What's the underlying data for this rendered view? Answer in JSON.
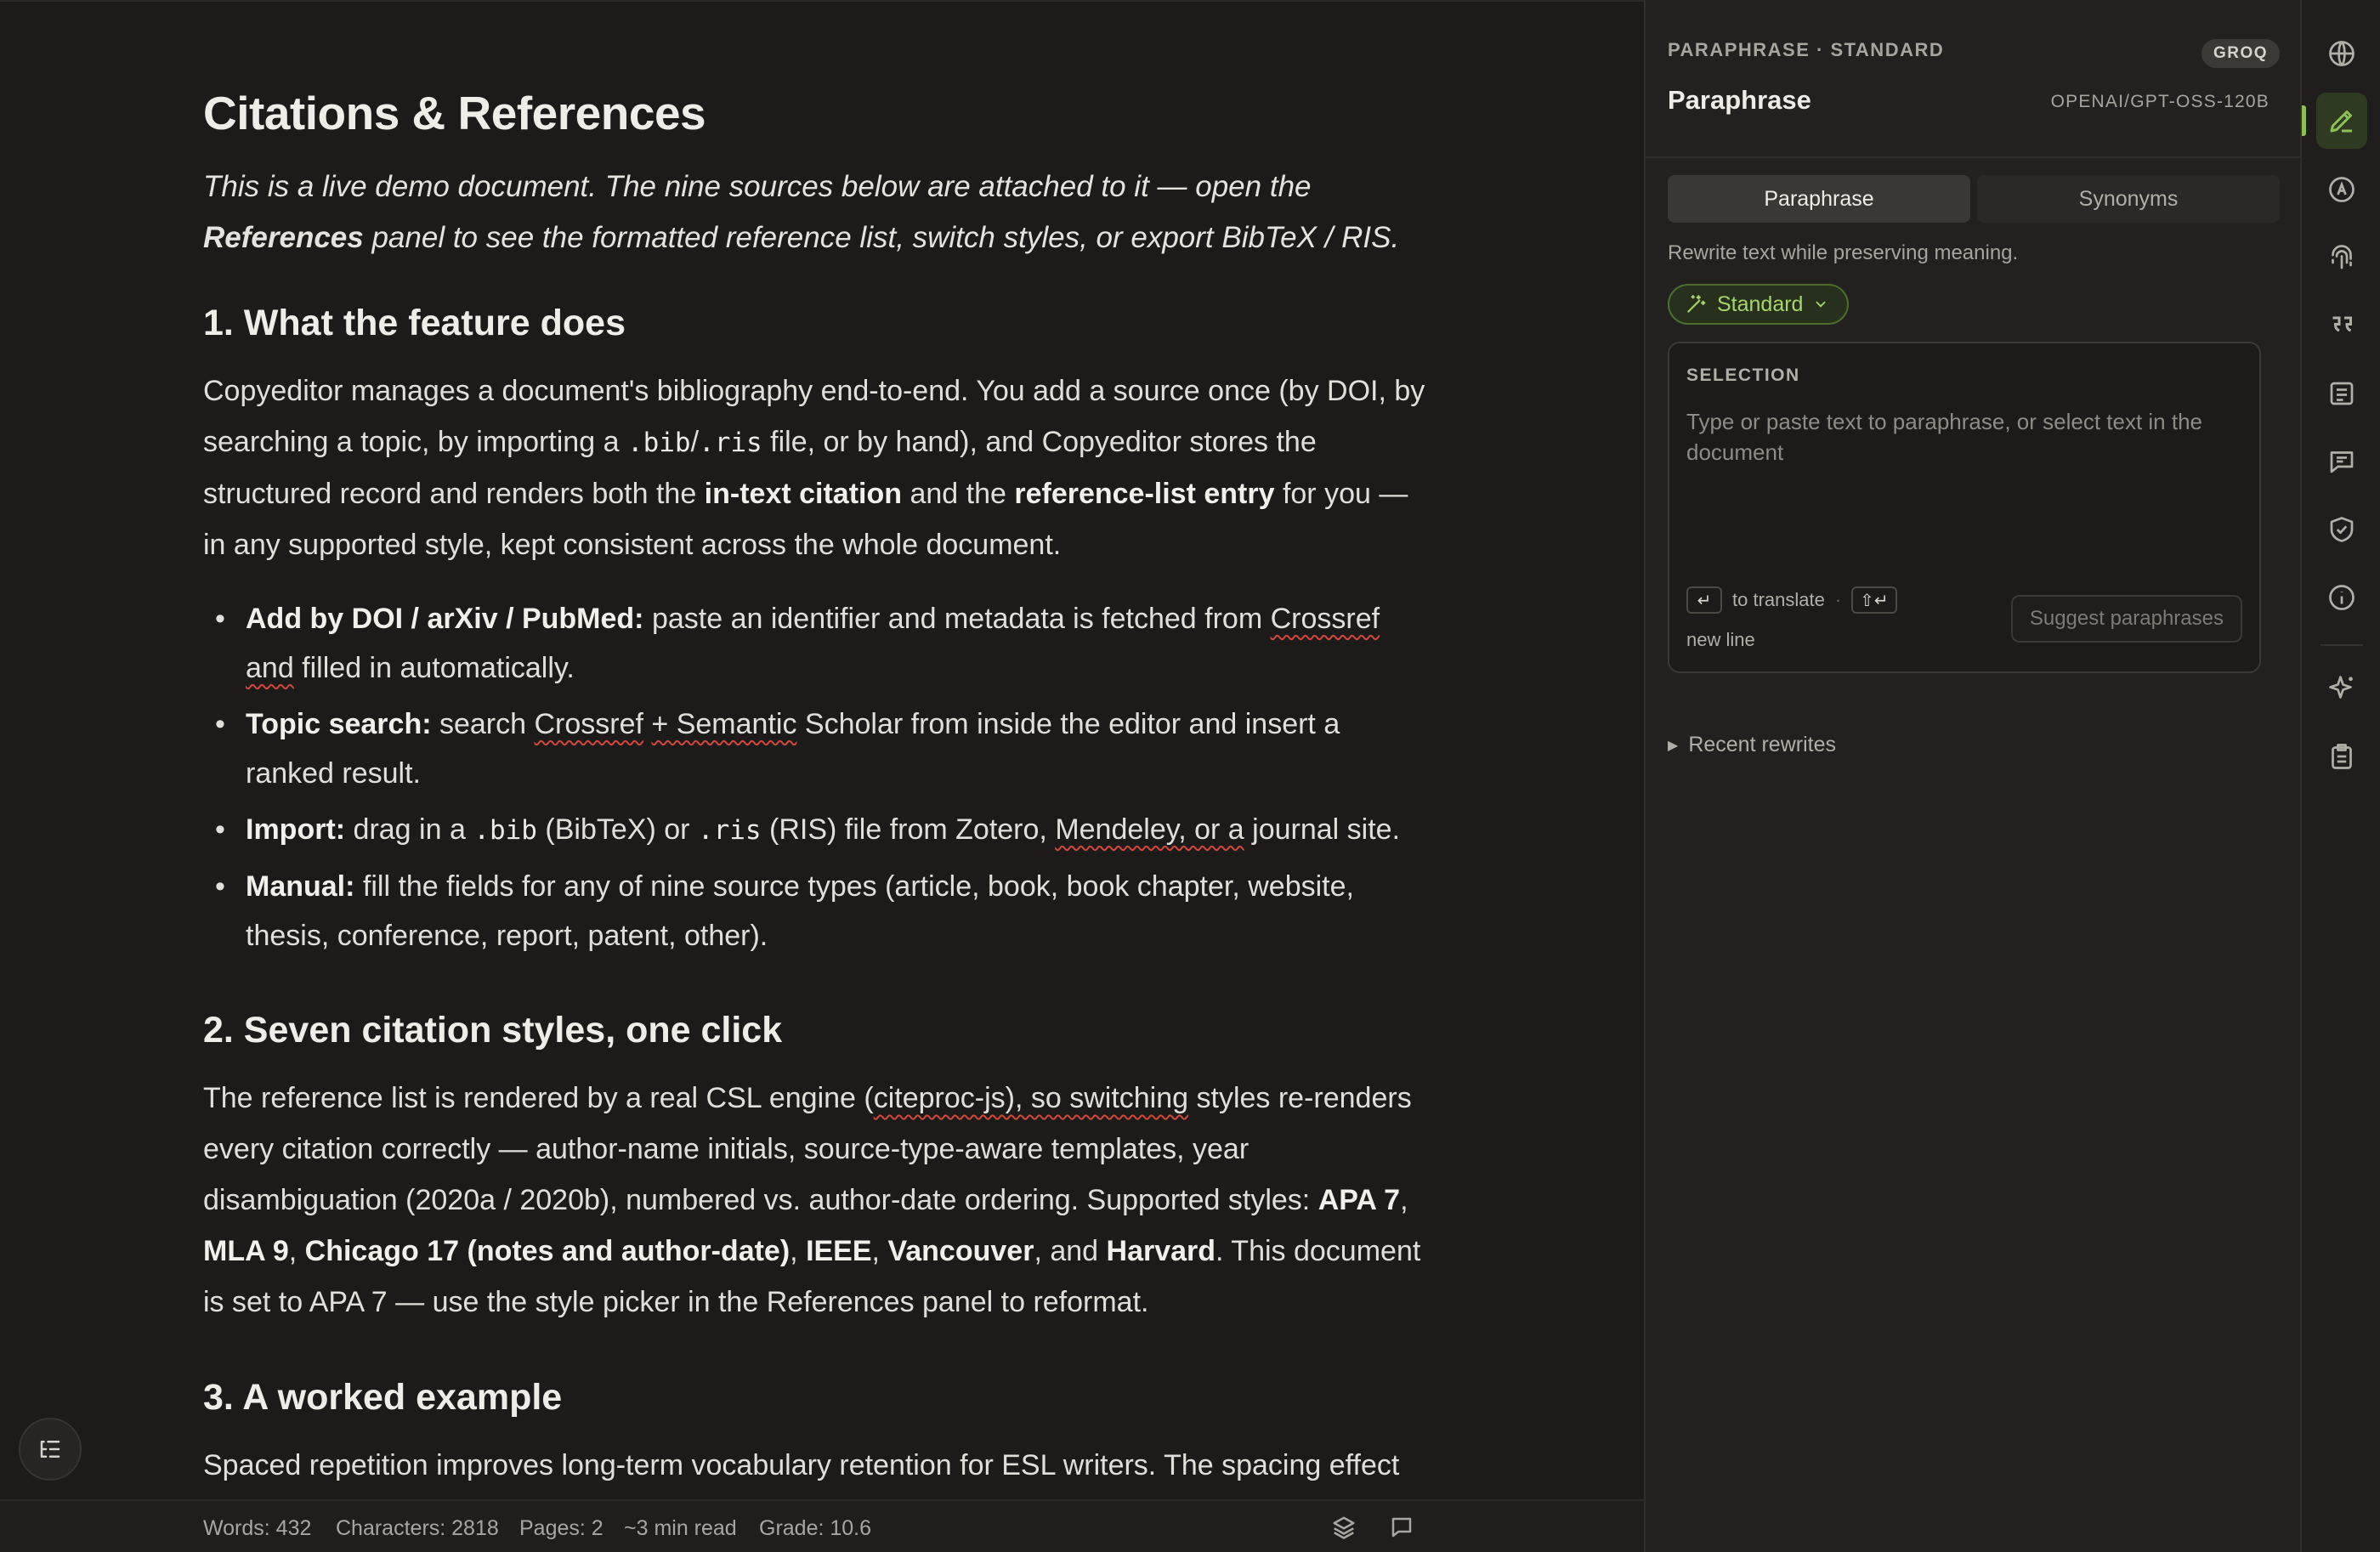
{
  "document": {
    "title": "Citations & References",
    "intro_part1": "This is a live demo document. The nine sources below are attached to it — open the ",
    "intro_bold": "References",
    "intro_part2": " panel to see the formatted reference list, switch styles, or export BibTeX / RIS.",
    "section1": {
      "heading": "1. What the feature does",
      "p_a": "Copyeditor manages a document's bibliography end-to-end. You add a source once (by DOI, by searching a topic, by importing a ",
      "code_bib": ".bib",
      "slash": "/",
      "code_ris": ".ris",
      "p_b": " file, or by hand), and Copyeditor stores the structured record and renders both the ",
      "bold_intext": "in-text citation",
      "p_c": " and the ",
      "bold_entry": "reference-list entry",
      "p_d": " for you — in any supported style, kept consistent across the whole document.",
      "bullets": {
        "b1_bold": "Add by DOI / arXiv / PubMed:",
        "b1_a": " paste an identifier and metadata is fetched from ",
        "b1_sq": "Crossref and",
        "b1_b": " filled in automatically.",
        "b2_bold": "Topic search:",
        "b2_a": " search ",
        "b2_sq1": "Crossref",
        "b2_b": " ",
        "b2_sq2": "+ Semantic",
        "b2_c": " Scholar from inside the editor and insert a ranked result.",
        "b3_bold": "Import:",
        "b3_a": " drag in a ",
        "b3_code1": ".bib",
        "b3_b": " (BibTeX) or ",
        "b3_code2": ".ris",
        "b3_c": " (RIS) file from Zotero, ",
        "b3_sq": "Mendeley, or a",
        "b3_d": " journal site.",
        "b4_bold": "Manual:",
        "b4_a": " fill the fields for any of nine source types (article, book, book chapter, website, thesis, conference, report, patent, other)."
      }
    },
    "section2": {
      "heading": "2. Seven citation styles, one click",
      "p_a": "The reference list is rendered by a real CSL engine (",
      "p_sq": "citeproc-js), so switching",
      "p_b": " styles re-renders every citation correctly — author-name initials, source-type-aware templates, year disambiguation (2020a / 2020b), numbered vs. author-date ordering. Supported styles: ",
      "s_apa": "APA 7",
      "comma": ", ",
      "s_mla": "MLA 9",
      "s_chicago": "Chicago 17 (notes and author-date)",
      "s_ieee": "IEEE",
      "s_vancouver": "Vancouver",
      "and": ", and ",
      "s_harvard": "Harvard",
      "p_c": ". This document is set to APA 7 — use the style picker in the References panel to reformat."
    },
    "section3": {
      "heading": "3. A worked example",
      "p_partial": "Spaced repetition improves long-term vocabulary retention for ESL writers. The spacing effect"
    }
  },
  "statusbar": {
    "words": "Words: 432",
    "characters": "Characters: 2818",
    "pages": "Pages: 2",
    "read_time": "~3 min read",
    "grade": "Grade: 10.6"
  },
  "panel": {
    "header_overline": "PARAPHRASE · STANDARD",
    "title": "Paraphrase",
    "provider_badge": "GROQ",
    "model": "OPENAI/GPT-OSS-120B",
    "tabs": [
      "Paraphrase",
      "Synonyms"
    ],
    "active_tab": "Paraphrase",
    "subtitle": "Rewrite text while preserving meaning.",
    "mode": "Standard",
    "selection_label": "SELECTION",
    "selection_placeholder": "Type or paste text to paraphrase, or select text in the document",
    "hint_translate": "to translate",
    "hint_dot": "·",
    "hint_newline": "new line",
    "suggest_button": "Suggest paraphrases",
    "recent_rewrites": "Recent rewrites"
  },
  "colors": {
    "accent": "#8cc152",
    "background": "#1c1b1a",
    "panel": "#22211f",
    "spellcheck": "#d2483a"
  },
  "rail_icons": [
    "globe-icon",
    "pen-icon",
    "at-sign-icon",
    "fingerprint-icon",
    "quote-icon",
    "list-icon",
    "comment-icon",
    "shield-check-icon",
    "info-icon",
    "sparkle-icon",
    "clipboard-icon"
  ]
}
